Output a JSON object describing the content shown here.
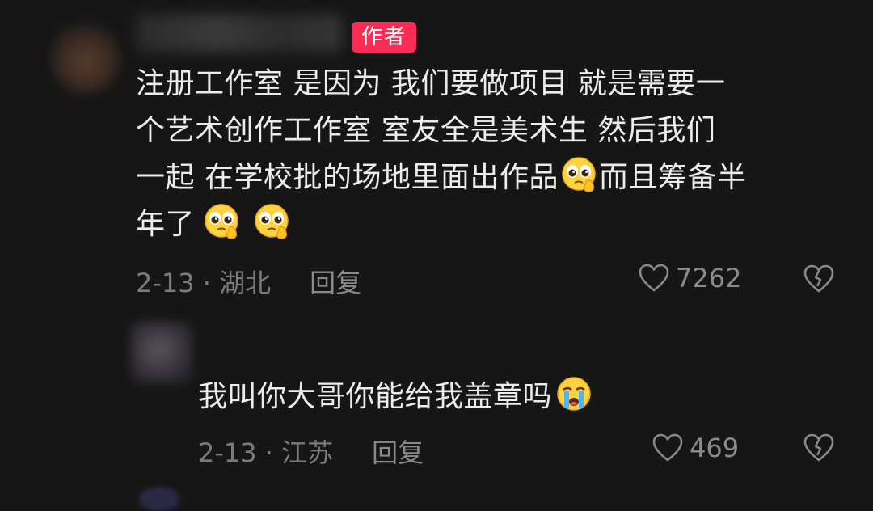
{
  "comments": [
    {
      "badge": "作者",
      "text_lines": [
        "注册工作室  是因为  我们要做项目 就是需要一",
        "个艺术创作工作室    室友全是美术生  然后我们",
        "一起 在学校批的场地里面出作品",
        "而且筹备半",
        "年了"
      ],
      "emoji_icons": [
        "pleading-face-icon",
        "pleading-face-icon",
        "pleading-face-icon"
      ],
      "date_location": "2-13 · 湖北",
      "reply_label": "回复",
      "likes": "7262"
    },
    {
      "text": "我叫你大哥你能给我盖章吗",
      "emoji_icons": [
        "crying-face-icon"
      ],
      "date_location": "2-13 · 江苏",
      "reply_label": "回复",
      "likes": "469"
    }
  ],
  "colors": {
    "background": "#161616",
    "badge": "#fa2c55",
    "text": "#ececec",
    "meta": "#7b7b7b"
  }
}
